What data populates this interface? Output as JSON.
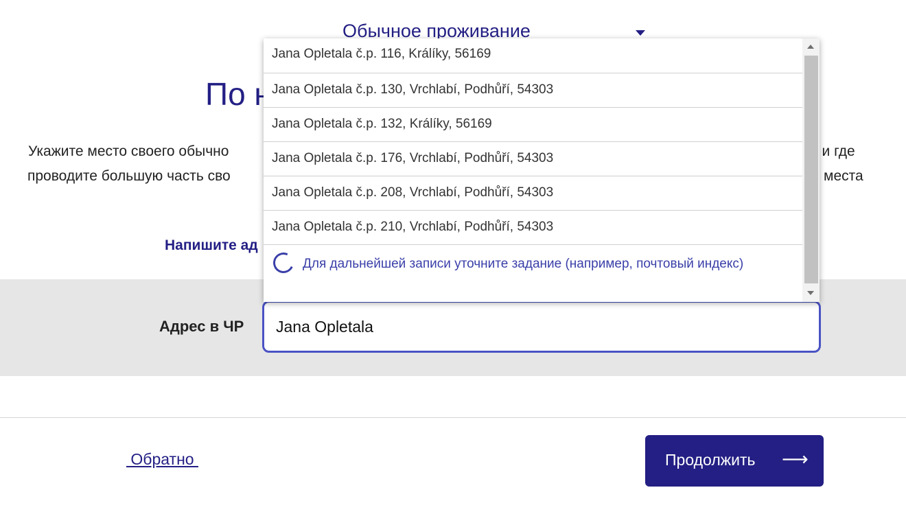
{
  "residence_select": {
    "value": "Обычное проживание",
    "icon": "chevron-down-icon"
  },
  "page": {
    "title": "По н",
    "intro_line1_left": "Укажите место своего обычно",
    "intro_line1_right": "о и где",
    "intro_line2_left": "проводите большую часть сво",
    "intro_line2_right": "места",
    "prompt_heading": "Напишите ад"
  },
  "address": {
    "label": "Адрес в ЧР",
    "value": "Jana Opletala"
  },
  "suggestions": {
    "items": [
      "Jana Opletala č.p. 116, Králíky, 56169",
      "Jana Opletala č.p. 130, Vrchlabí, Podhůří, 54303",
      "Jana Opletala č.p. 132, Králíky, 56169",
      "Jana Opletala č.p. 176, Vrchlabí, Podhůří, 54303",
      "Jana Opletala č.p. 208, Vrchlabí, Podhůří, 54303",
      "Jana Opletala č.p. 210, Vrchlabí, Podhůří, 54303"
    ],
    "notice": "Для дальнейшей записи уточните задание (например, почтовый индекс)"
  },
  "footer": {
    "back_label": " Обратно ",
    "continue_label": "Продолжить",
    "continue_icon": "arrow-right-icon"
  },
  "colors": {
    "brand": "#231f84",
    "input_border": "#4a52c4",
    "band": "#e6e6e6"
  }
}
